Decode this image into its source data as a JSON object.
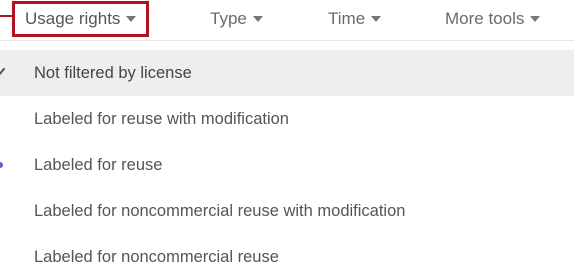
{
  "toolbar": {
    "usage_rights": "Usage rights",
    "type": "Type",
    "time": "Time",
    "more_tools": "More tools"
  },
  "menu": {
    "items": [
      {
        "label": "Not filtered by license",
        "selected": true
      },
      {
        "label": "Labeled for reuse with modification",
        "selected": false
      },
      {
        "label": "Labeled for reuse",
        "selected": false
      },
      {
        "label": "Labeled for noncommercial reuse with modification",
        "selected": false
      },
      {
        "label": "Labeled for noncommercial reuse",
        "selected": false
      }
    ]
  },
  "colors": {
    "highlight_border": "#b3131c",
    "selected_bg": "#eeeeee",
    "text": "#555555",
    "marker": "#5b5fc7"
  },
  "icons": {
    "dropdown": "caret-down-icon",
    "selected": "checkmark-icon"
  }
}
